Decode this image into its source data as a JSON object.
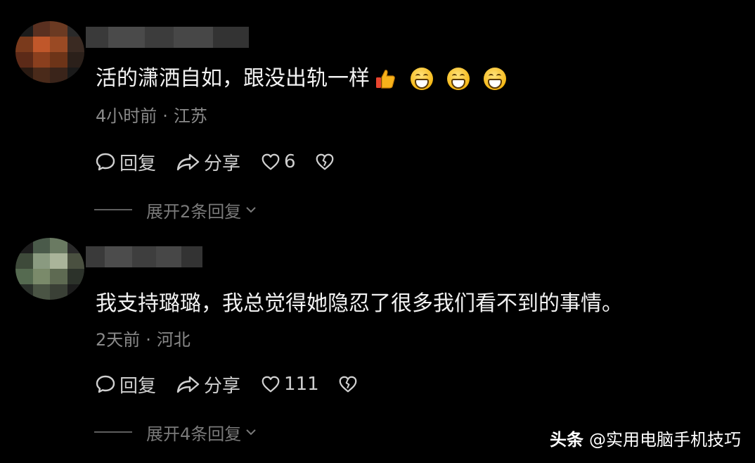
{
  "comments": [
    {
      "text": "活的潇洒自如，跟没出轨一样",
      "emojis": [
        "thumbs-up",
        "grinning-face",
        "grinning-face",
        "grinning-face"
      ],
      "time": "4小时前",
      "separator": "·",
      "location": "江苏",
      "reply_label": "回复",
      "share_label": "分享",
      "likes": "6",
      "expand_label": "展开2条回复"
    },
    {
      "text": "我支持璐璐，我总觉得她隐忍了很多我们看不到的事情。",
      "time": "2天前",
      "separator": "·",
      "location": "河北",
      "reply_label": "回复",
      "share_label": "分享",
      "likes": "111",
      "expand_label": "展开4条回复"
    }
  ],
  "watermark": {
    "brand": "头条",
    "account": "@实用电脑手机技巧"
  },
  "colors": {
    "background": "#000000",
    "text_primary": "#f2f2f2",
    "text_meta": "#8a8a8a",
    "text_expand": "#7a7a7a"
  }
}
